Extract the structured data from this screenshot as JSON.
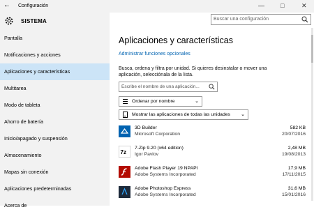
{
  "window": {
    "title": "Configuración",
    "back_glyph": "←",
    "controls": {
      "minimize": "—",
      "maximize": "□",
      "close": "✕"
    }
  },
  "sidebar": {
    "brand": "SISTEMA",
    "items": [
      {
        "label": "Pantalla"
      },
      {
        "label": "Notificaciones y acciones"
      },
      {
        "label": "Aplicaciones y características",
        "active": true
      },
      {
        "label": "Multitarea"
      },
      {
        "label": "Modo de tableta"
      },
      {
        "label": "Ahorro de batería"
      },
      {
        "label": "Inicio/apagado y suspensión"
      },
      {
        "label": "Almacenamiento"
      },
      {
        "label": "Mapas sin conexión"
      },
      {
        "label": "Aplicaciones predeterminadas"
      },
      {
        "label": "Acerca de"
      }
    ]
  },
  "search": {
    "placeholder": "Buscar una configuración"
  },
  "main": {
    "title": "Aplicaciones y características",
    "link": "Administrar funciones opcionales",
    "description": "Busca, ordena y filtra por unidad. Si quieres desinstalar o mover una aplicación, selecciónala de la lista.",
    "filter_placeholder": "Escribe el nombre de una aplicación...",
    "sort_label": "Ordenar por nombre",
    "drive_label": "Mostrar las aplicaciones de todas las unidades",
    "apps": [
      {
        "name": "3D Builder",
        "publisher": "Microsoft Corporation",
        "size": "582 KB",
        "date": "20/07/2016",
        "icon": "3d-builder-icon",
        "color": "#0063b1"
      },
      {
        "name": "7-Zip 9.20 (x64 edition)",
        "publisher": "Igor Pavlov",
        "size": "2,48 MB",
        "date": "19/08/2013",
        "icon": "7zip-icon",
        "color": "#ffffff"
      },
      {
        "name": "Adobe Flash Player 19 NPAPI",
        "publisher": "Adobe Systems Incorporated",
        "size": "17,9 MB",
        "date": "17/11/2015",
        "icon": "flash-icon",
        "color": "#b30b00"
      },
      {
        "name": "Adobe Photoshop Express",
        "publisher": "Adobe Systems Incorporated",
        "size": "31,6 MB",
        "date": "15/01/2016",
        "icon": "photoshop-express-icon",
        "color": "#1d2a3a"
      }
    ]
  },
  "colors": {
    "accent": "#0063b1",
    "selected": "#cce4f7",
    "sidebar_bg": "#f2f2f2"
  }
}
